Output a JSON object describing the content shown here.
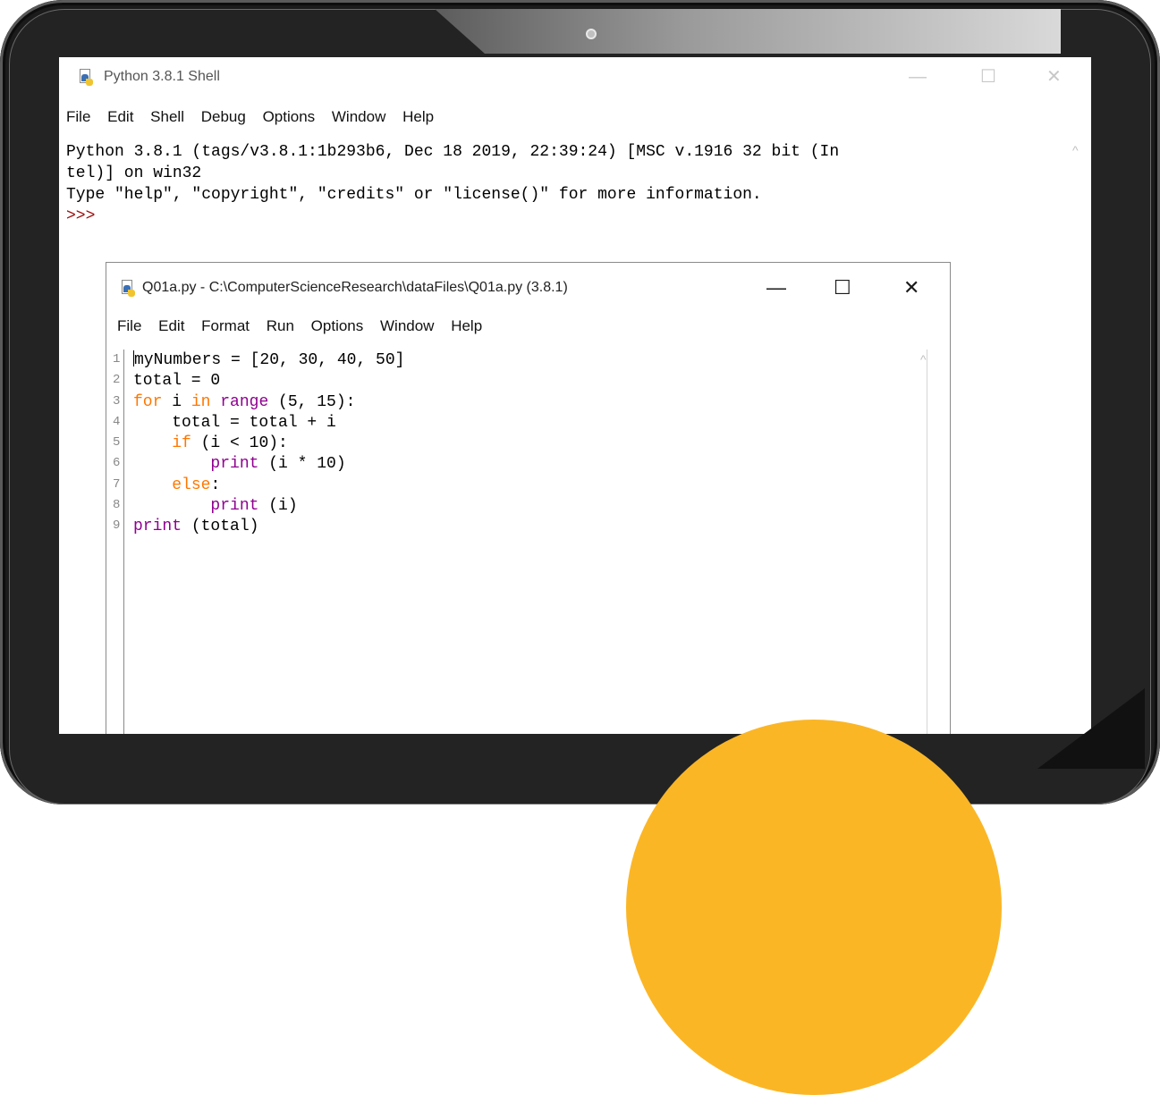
{
  "shell": {
    "title": "Python 3.8.1 Shell",
    "menu": [
      "File",
      "Edit",
      "Shell",
      "Debug",
      "Options",
      "Window",
      "Help"
    ],
    "lines": [
      "Python 3.8.1 (tags/v3.8.1:1b293b6, Dec 18 2019, 22:39:24) [MSC v.1916 32 bit (In",
      "tel)] on win32",
      "Type \"help\", \"copyright\", \"credits\" or \"license()\" for more information."
    ],
    "prompt": ">>>",
    "controls": {
      "minimize": "—",
      "maximize": "☐",
      "close": "✕"
    }
  },
  "editor": {
    "title": "Q01a.py - C:\\ComputerScienceResearch\\dataFiles\\Q01a.py (3.8.1)",
    "menu": [
      "File",
      "Edit",
      "Format",
      "Run",
      "Options",
      "Window",
      "Help"
    ],
    "line_numbers": [
      "1",
      "2",
      "3",
      "4",
      "5",
      "6",
      "7",
      "8",
      "9"
    ],
    "code": [
      "myNumbers = [20, 30, 40, 50]",
      "total = 0",
      "for i in range (5, 15):",
      "    total = total + i",
      "    if (i < 10):",
      "        print (i * 10)",
      "    else:",
      "        print (i)",
      "print (total)"
    ],
    "controls": {
      "minimize": "—",
      "maximize": "☐",
      "close": "✕"
    }
  },
  "colors": {
    "keyword": "#ff7700",
    "builtin": "#900090",
    "prompt": "#a01010",
    "accent_circle": "#fbb626",
    "tablet_frame": "#1b1b1b"
  },
  "icons": [
    "python-file-icon",
    "minimize-icon",
    "maximize-icon",
    "close-icon",
    "scroll-up-icon",
    "camera-icon"
  ]
}
